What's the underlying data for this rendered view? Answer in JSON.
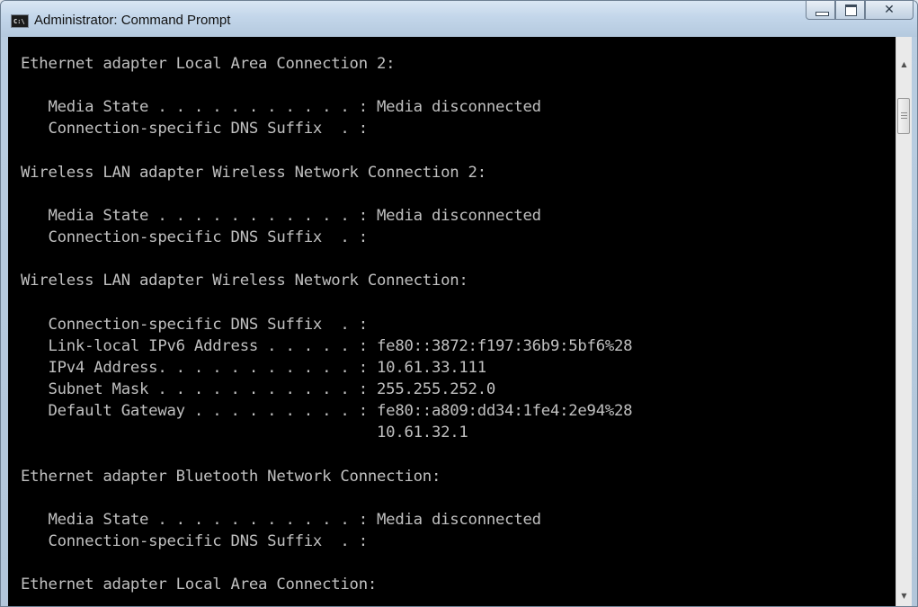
{
  "window": {
    "title": "Administrator: Command Prompt",
    "icon": "console-icon",
    "icon_glyph": "C:\\",
    "buttons": {
      "minimize": "minimize-icon",
      "maximize": "maximize-icon",
      "close": "close-icon",
      "close_glyph": "✕"
    }
  },
  "console": {
    "lines": [
      "Ethernet adapter Local Area Connection 2:",
      "",
      "   Media State . . . . . . . . . . . : Media disconnected",
      "   Connection-specific DNS Suffix  . :",
      "",
      "Wireless LAN adapter Wireless Network Connection 2:",
      "",
      "   Media State . . . . . . . . . . . : Media disconnected",
      "   Connection-specific DNS Suffix  . :",
      "",
      "Wireless LAN adapter Wireless Network Connection:",
      "",
      "   Connection-specific DNS Suffix  . :",
      "   Link-local IPv6 Address . . . . . : fe80::3872:f197:36b9:5bf6%28",
      "   IPv4 Address. . . . . . . . . . . : 10.61.33.111",
      "   Subnet Mask . . . . . . . . . . . : 255.255.252.0",
      "   Default Gateway . . . . . . . . . : fe80::a809:dd34:1fe4:2e94%28",
      "                                       10.61.32.1",
      "",
      "Ethernet adapter Bluetooth Network Connection:",
      "",
      "   Media State . . . . . . . . . . . : Media disconnected",
      "   Connection-specific DNS Suffix  . :",
      "",
      "Ethernet adapter Local Area Connection:"
    ]
  },
  "scrollbar": {
    "up_arrow": "▲",
    "down_arrow": "▼"
  },
  "colors": {
    "console_bg": "#000000",
    "console_text": "#c0c0c0",
    "titlebar": "#c3d6ea"
  }
}
